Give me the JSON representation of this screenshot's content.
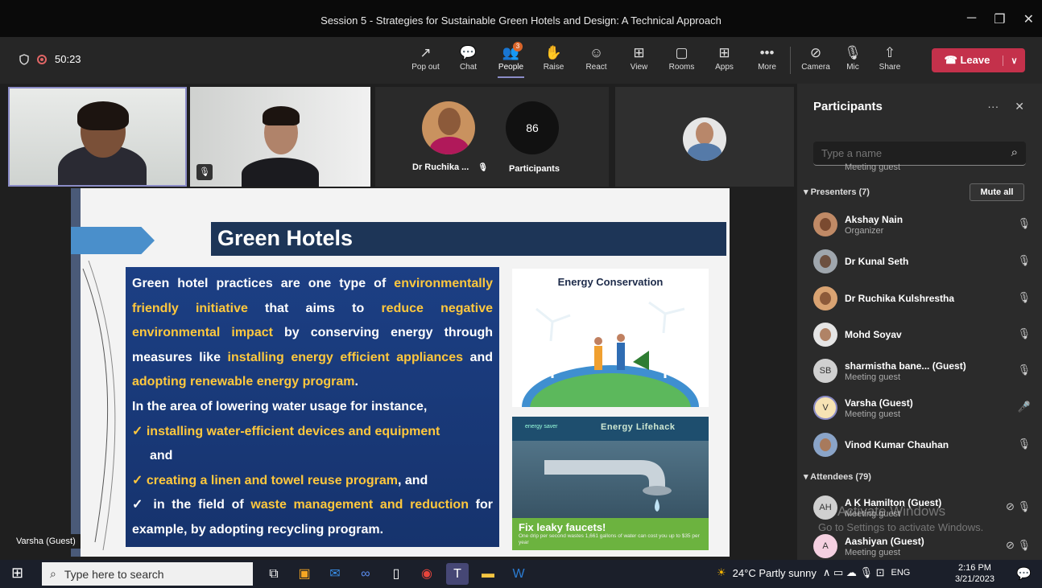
{
  "window": {
    "title": "Session 5 - Strategies for Sustainable Green Hotels and Design: A Technical Approach",
    "min": "─",
    "max": "❐",
    "close": "✕"
  },
  "toolbar": {
    "timer": "50:23",
    "items": [
      {
        "label": "Pop out",
        "icon": "↗"
      },
      {
        "label": "Chat",
        "icon": "💬"
      },
      {
        "label": "People",
        "icon": "👥",
        "badge": "3"
      },
      {
        "label": "Raise",
        "icon": "✋"
      },
      {
        "label": "React",
        "icon": "☺"
      },
      {
        "label": "View",
        "icon": "⊞"
      },
      {
        "label": "Rooms",
        "icon": "▢"
      },
      {
        "label": "Apps",
        "icon": "⊞"
      },
      {
        "label": "More",
        "icon": "•••"
      }
    ],
    "devices": [
      {
        "label": "Camera",
        "icon": "⊘"
      },
      {
        "label": "Mic",
        "icon": "🎙"
      },
      {
        "label": "Share",
        "icon": "⇧"
      }
    ],
    "leave": "Leave",
    "leave_drop": "∨"
  },
  "stage": {
    "tile3_name": "Dr Ruchika ...",
    "mic_off": "🎙",
    "participants_count": "86",
    "participants_label": "Participants",
    "speaker_label": "Varsha (Guest)"
  },
  "slide": {
    "title": "Green Hotels",
    "p1_a": "Green hotel practices are one type of ",
    "p1_b": "environmentally friendly initiative",
    "p1_c": " that aims to ",
    "p1_d": "reduce negative environmental impact",
    "p1_e": " by conserving energy through measures like ",
    "p1_f": "installing energy efficient appliances",
    "p1_g": " and ",
    "p1_h": "adopting renewable energy program",
    "p1_i": ".",
    "p2": "In the area of lowering water usage for instance,",
    "check": "✓",
    "b1": "installing water-efficient devices and equipment",
    "b1_tail": "and",
    "b2": "creating a linen and towel reuse program",
    "b2_tail": ", and",
    "b3_a": "in the field of ",
    "b3_b": "waste management and reduction",
    "b3_c": " for example, by adopting recycling program.",
    "img1_title": "Energy Conservation",
    "img2_brand": "energy saver",
    "img2_header": "Energy Lifehack",
    "img2_cta": "Fix leaky faucets!",
    "img2_fine": "One drip per second wastes 1,661 gallons of water can cost you up to $35 per year"
  },
  "panel": {
    "title": "Participants",
    "more": "···",
    "close": "✕",
    "search_placeholder": "Type a name",
    "top_partial_role": "Meeting guest",
    "presenters_caption": "▾ Presenters (7)",
    "mute_all": "Mute all",
    "presenters": [
      {
        "name": "Akshay Nain",
        "role": "Organizer",
        "mic": "🎙"
      },
      {
        "name": "Dr Kunal Seth",
        "role": "",
        "mic": "🎙"
      },
      {
        "name": "Dr Ruchika Kulshrestha",
        "role": "",
        "mic": "🎙"
      },
      {
        "name": "Mohd Soyav",
        "role": "",
        "mic": "🎙"
      },
      {
        "name": "sharmistha bane... (Guest)",
        "role": "Meeting guest",
        "initials": "SB",
        "mic": "🎙"
      },
      {
        "name": "Varsha (Guest)",
        "role": "Meeting guest",
        "initials": "V",
        "mic": "🎤"
      },
      {
        "name": "Vinod Kumar Chauhan",
        "role": "",
        "mic": "🎙"
      }
    ],
    "attendees_caption": "▾ Attendees (79)",
    "attendees": [
      {
        "name": "A K Hamilton (Guest)",
        "role": "Meeting guest",
        "initials": "AH",
        "mic": "⊘ 🎙"
      },
      {
        "name": "Aashiyan (Guest)",
        "role": "Meeting guest",
        "initials": "A",
        "mic": "⊘ 🎙"
      }
    ],
    "watermark_title": "Activate Windows",
    "watermark_sub": "Go to Settings to activate Windows."
  },
  "taskbar": {
    "start": "⊞",
    "search_icon": "⌕",
    "search_placeholder": "Type here to search",
    "weather": "24°C  Partly sunny",
    "tray_icons": "∧ ▭ ☁ 🎙 ⊡",
    "lang": "ENG",
    "time": "2:16 PM",
    "date": "3/21/2023",
    "notif": "💬"
  },
  "colors": {
    "accent": "#8b8cc7",
    "leave": "#c4314b",
    "highlight": "#ffc83d",
    "slide_box": "#1c3f84"
  }
}
